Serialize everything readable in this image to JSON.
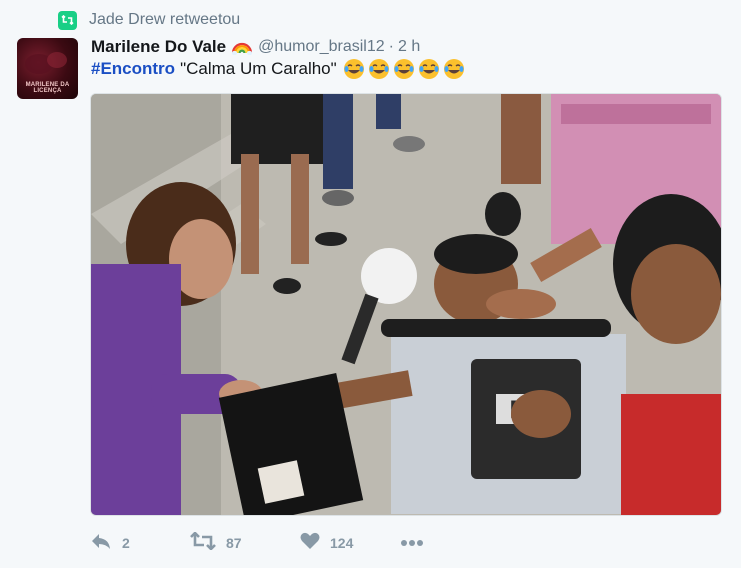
{
  "retweet": {
    "icon": "retweet-icon",
    "label": "Jade Drew retweetou"
  },
  "author": {
    "avatar_label": "MARILENE DA LICENÇA",
    "name": "Marilene Do Vale",
    "name_emoji": "rainbow-icon",
    "handle": "@humor_brasil12",
    "separator": "·",
    "time": "2 h"
  },
  "tweet": {
    "hashtag": "#Encontro",
    "text": "\"Calma Um Caralho\"",
    "emojis": [
      "joy-emoji",
      "joy-emoji",
      "joy-emoji",
      "joy-emoji",
      "joy-emoji"
    ]
  },
  "media": {
    "description_icon": "photo"
  },
  "actions": {
    "reply": {
      "icon": "reply-icon",
      "count": "2"
    },
    "retweet": {
      "icon": "retweet-icon",
      "count": "87"
    },
    "like": {
      "icon": "heart-icon",
      "count": "124"
    },
    "more": {
      "icon": "more-icon"
    }
  },
  "colors": {
    "retweet_green": "#19cf86",
    "hashtag_blue": "#1b4fc4",
    "muted": "#657786",
    "action_gray": "#8899a6"
  }
}
